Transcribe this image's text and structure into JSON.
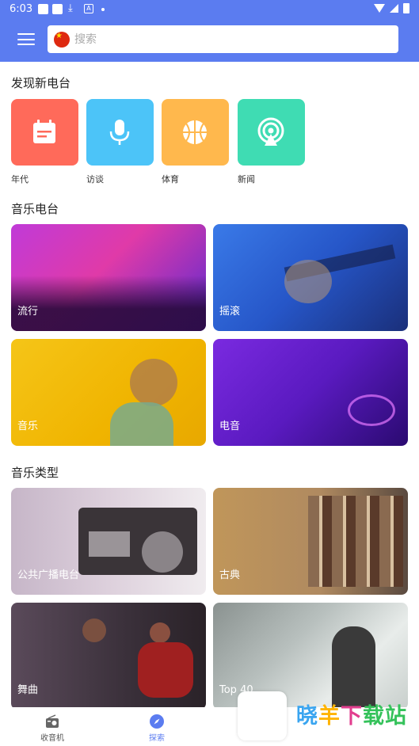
{
  "status": {
    "time": "6:03"
  },
  "search": {
    "placeholder": "搜索"
  },
  "sections": {
    "discover": "发现新电台",
    "music_radio": "音乐电台",
    "music_genres": "音乐类型"
  },
  "discover_items": [
    {
      "label": "年代",
      "icon": "calendar-icon",
      "color": "#ff6a5a"
    },
    {
      "label": "访谈",
      "icon": "microphone-icon",
      "color": "#4cc4f8"
    },
    {
      "label": "体育",
      "icon": "basketball-icon",
      "color": "#ffb84d"
    },
    {
      "label": "新闻",
      "icon": "broadcast-icon",
      "color": "#3fdcb3"
    }
  ],
  "music_radio_cards": [
    {
      "label": "流行"
    },
    {
      "label": "摇滚"
    },
    {
      "label": "音乐"
    },
    {
      "label": "电音"
    }
  ],
  "genre_cards": [
    {
      "label": "公共广播电台"
    },
    {
      "label": "古典"
    },
    {
      "label": "舞曲"
    },
    {
      "label": "Top 40"
    }
  ],
  "bottom_nav": [
    {
      "label": "收音机",
      "icon": "radio-icon",
      "active": false
    },
    {
      "label": "探索",
      "icon": "compass-icon",
      "active": true
    }
  ],
  "watermark": [
    "晓",
    "羊",
    "下",
    "载站"
  ],
  "colors": {
    "primary": "#5b7cf0"
  }
}
